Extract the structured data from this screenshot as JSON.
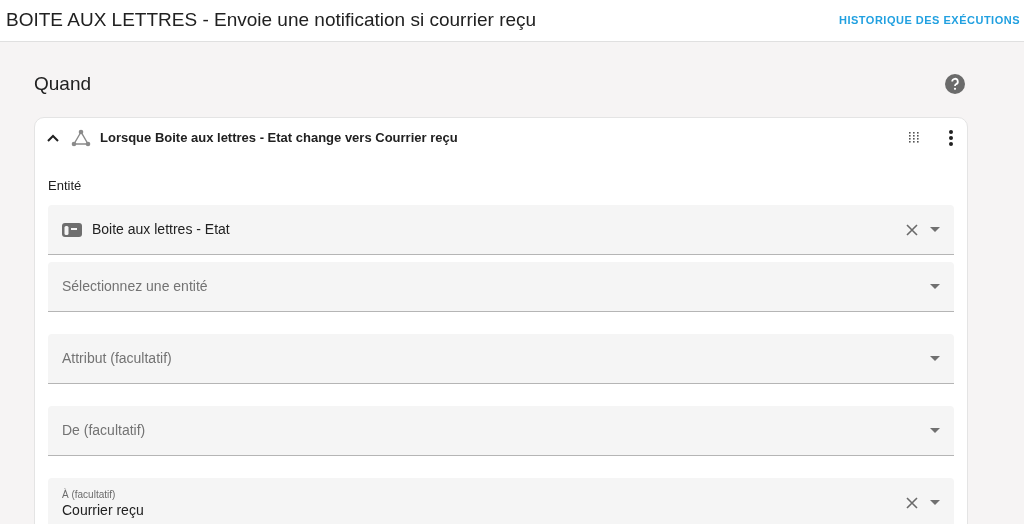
{
  "header": {
    "title": "BOITE AUX LETTRES - Envoie une notification si courrier reçu",
    "action": "HISTORIQUE DES EXÉCUTIONS"
  },
  "section": {
    "title": "Quand"
  },
  "trigger": {
    "expanded": true,
    "title": "Lorsque Boite aux lettres - Etat change vers Courrier reçu",
    "entity_label": "Entité",
    "entity_fields": [
      {
        "kind": "entity",
        "value": "Boite aux lettres - Etat",
        "clearable": true
      },
      {
        "kind": "select",
        "placeholder": "Sélectionnez une entité",
        "clearable": false
      }
    ],
    "fields": [
      {
        "kind": "select",
        "placeholder": "Attribut (facultatif)",
        "clearable": false
      },
      {
        "kind": "select",
        "placeholder": "De (facultatif)",
        "clearable": false
      },
      {
        "kind": "select",
        "label": "À (facultatif)",
        "value": "Courrier reçu",
        "clearable": true
      }
    ]
  }
}
